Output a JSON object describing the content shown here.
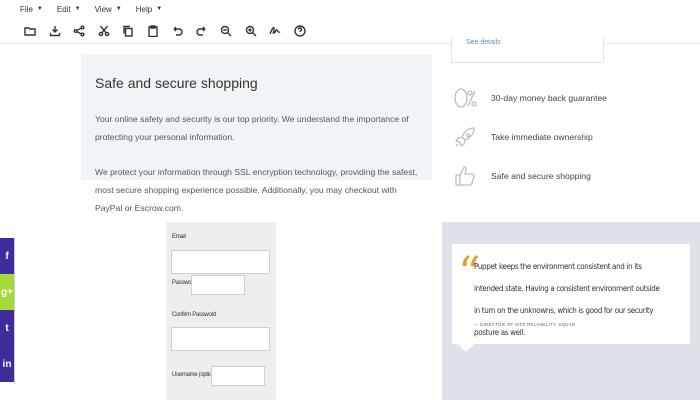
{
  "menubar": {
    "items": [
      {
        "label": "File"
      },
      {
        "label": "Edit"
      },
      {
        "label": "View"
      },
      {
        "label": "Help"
      }
    ]
  },
  "toolbar": {
    "icons": [
      "folder-icon",
      "download-icon",
      "share-icon",
      "cut-icon",
      "copy-icon",
      "clipboard-icon",
      "undo-icon",
      "redo-icon",
      "zoom-out-icon",
      "zoom-in-icon",
      "signature-icon",
      "help-icon"
    ]
  },
  "top_box": {
    "link": "See details"
  },
  "secure": {
    "title": "Safe and secure shopping",
    "p1": "Your online safety and security is our top priority. We understand the importance of protecting your personal information.",
    "p2": "We protect your information through SSL encryption technology, providing the safest, most secure shopping experience possible. Additionally, you may checkout with PayPal or Escrow.com."
  },
  "guarantees": [
    {
      "icon": "zero-percent-icon",
      "label": "30-day money back guarantee"
    },
    {
      "icon": "rocket-icon",
      "label": "Take immediate ownership"
    },
    {
      "icon": "thumbs-up-icon",
      "label": "Safe and secure shopping"
    }
  ],
  "form": {
    "email_label": "Email",
    "password_label": "Password",
    "confirm_label": "Confirm Password",
    "username_label": "Username (optional)"
  },
  "quote": {
    "mark": "“",
    "text": "Puppet keeps the environment consistent and in its intended state. Having a consistent environment outside in turn on the unknowns, which is good for our security posture as well.",
    "author": "— DIRECTOR OF SITE RELIABILITY, SQUAD"
  },
  "social": [
    {
      "icon": "facebook-icon",
      "glyph": "f"
    },
    {
      "icon": "google-plus-icon",
      "glyph": "g+"
    },
    {
      "icon": "twitter-icon",
      "glyph": "t"
    },
    {
      "icon": "linkedin-icon",
      "glyph": "in"
    }
  ],
  "colors": {
    "panel_bg": "#f0f4f7",
    "quote_bg": "#dde3e8",
    "quote_mark": "#e2a232",
    "social_primary": "#3f2c9a",
    "social_accent": "#a6d93a",
    "link": "#5b8fc7"
  }
}
